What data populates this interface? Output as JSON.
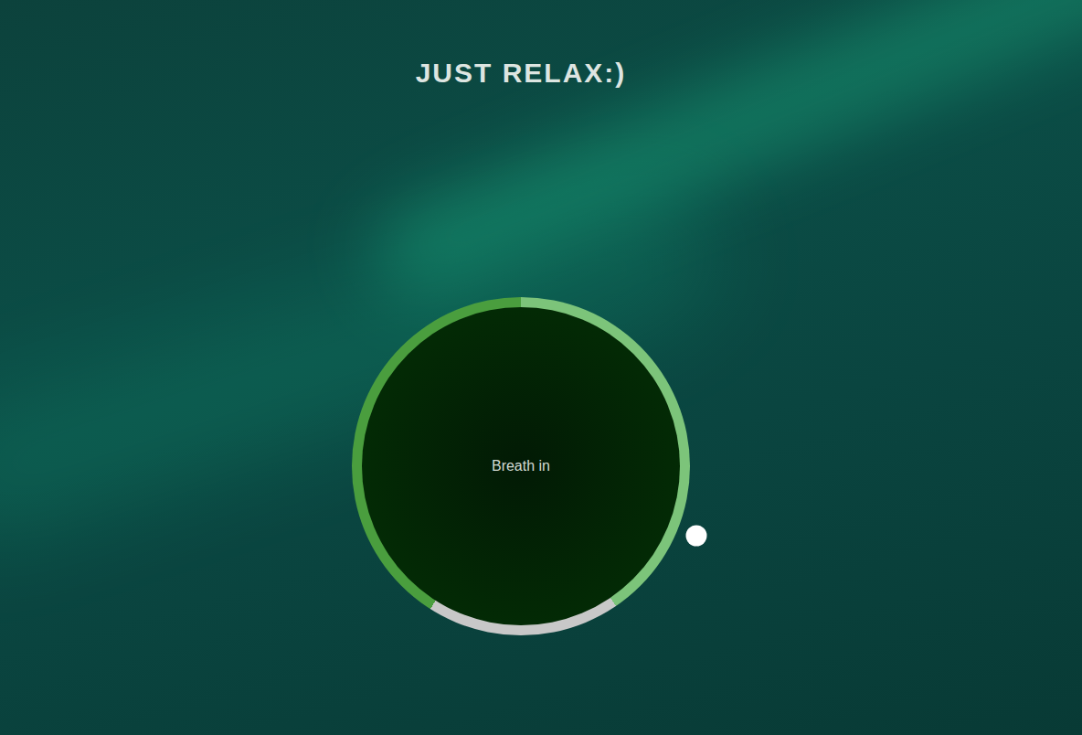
{
  "title": "JUST RELAX:)",
  "breathing_circle": {
    "phase": "Breath in",
    "pointer": {
      "level": 0.31
    },
    "segments": [
      {
        "color": "#7cc47a",
        "level": 0.405
      },
      {
        "color": "#c8c8c8",
        "level": 0.185
      },
      {
        "color": "#4a9e3e",
        "level": 0.41
      }
    ]
  }
}
